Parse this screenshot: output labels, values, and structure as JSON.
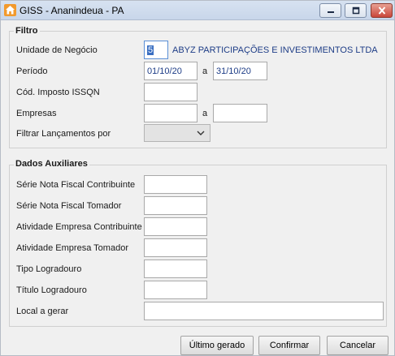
{
  "window": {
    "title": "GISS - Ananindeua - PA",
    "icon": "house-icon",
    "controls": [
      "minimize-icon",
      "maximize-icon",
      "close-icon"
    ]
  },
  "filtro": {
    "legend": "Filtro",
    "unidade_label": "Unidade de Negócio",
    "unidade_value": "5",
    "unidade_name": "ABYZ PARTICIPAÇÕES E INVESTIMENTOS LTDA",
    "periodo_label": "Período",
    "periodo_from": "01/10/20",
    "periodo_sep": "a",
    "periodo_to": "31/10/20",
    "cod_imposto_label": "Cód. Imposto ISSQN",
    "cod_imposto_value": "",
    "empresas_label": "Empresas",
    "empresas_from": "",
    "empresas_sep": "a",
    "empresas_to": "",
    "filtrar_label": "Filtrar Lançamentos por",
    "filtrar_value": ""
  },
  "dados": {
    "legend": "Dados Auxiliares",
    "serie_contribuinte_label": "Série Nota Fiscal Contribuinte",
    "serie_tomador_label": "Série Nota Fiscal Tomador",
    "atividade_contribuinte_label": "Atividade Empresa Contribuinte",
    "atividade_tomador_label": "Atividade Empresa Tomador",
    "tipo_logradouro_label": "Tipo Logradouro",
    "titulo_logradouro_label": "Título Logradouro",
    "local_gerar_label": "Local a gerar"
  },
  "buttons": {
    "ultimo": "Último gerado",
    "confirmar": "Confirmar",
    "cancelar": "Cancelar"
  },
  "colors": {
    "accent": "#3a6fc2",
    "value_text": "#1d3c86"
  }
}
